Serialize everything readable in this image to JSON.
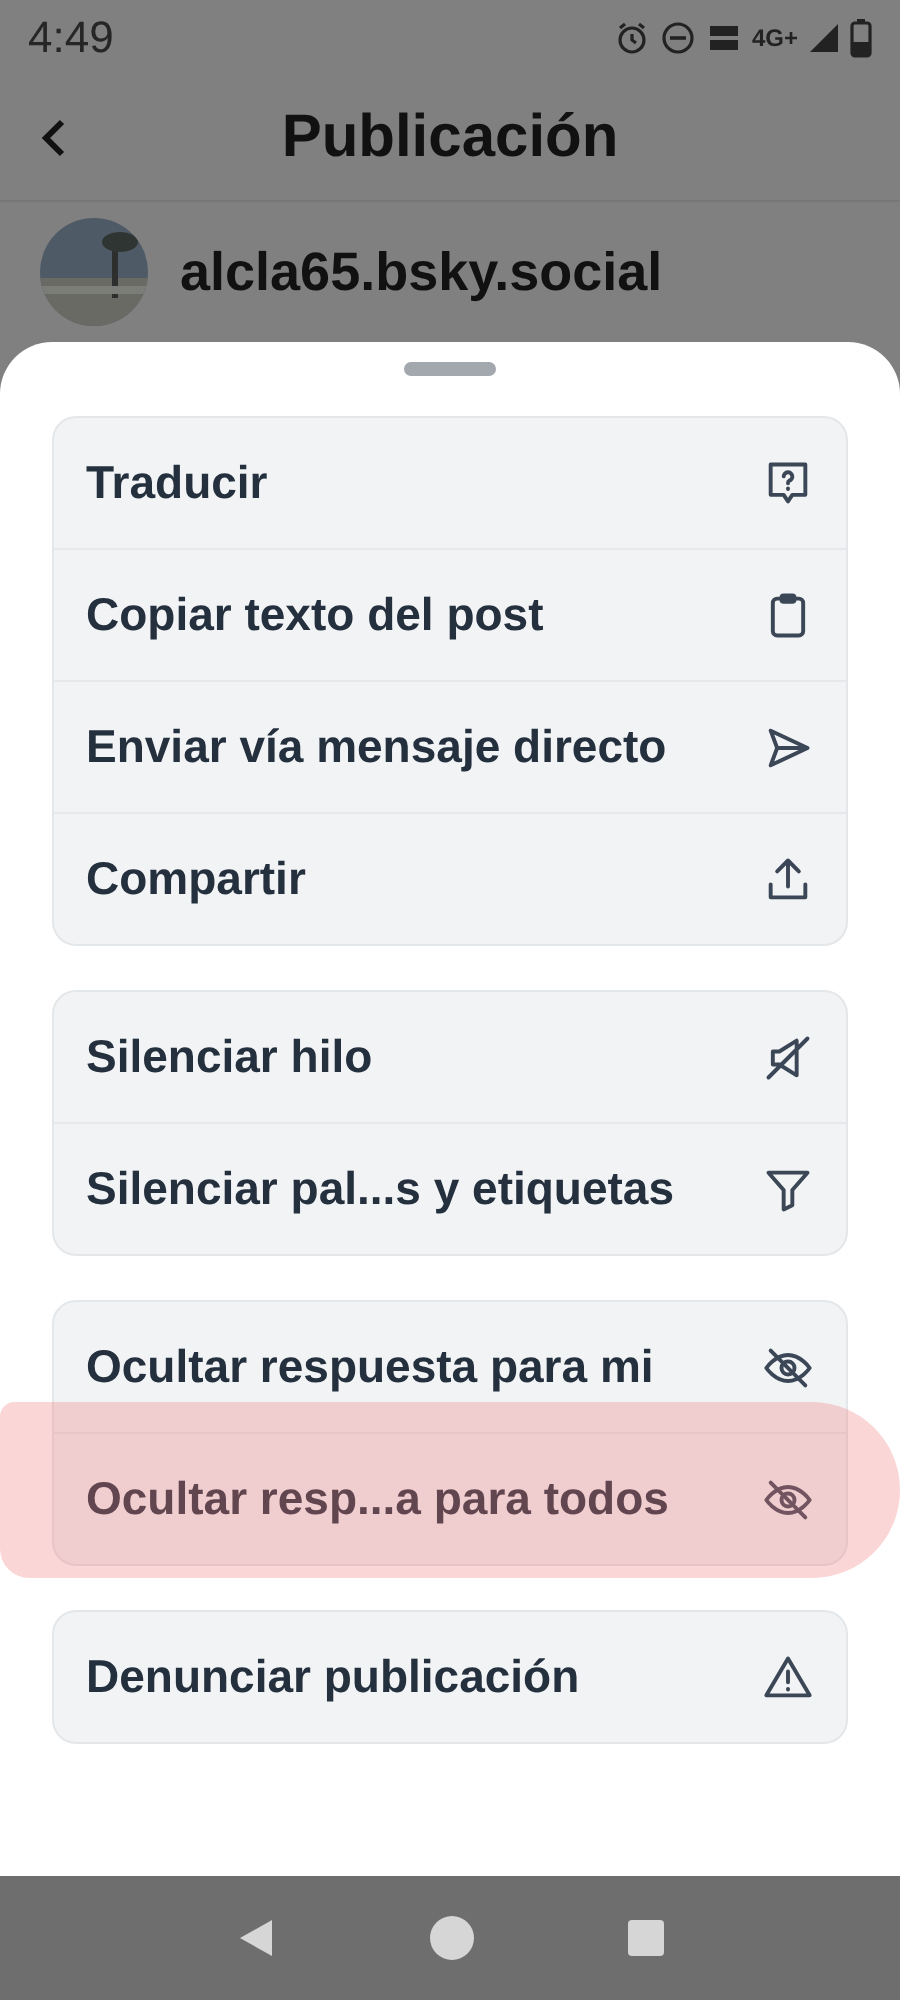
{
  "status_bar": {
    "time": "4:49",
    "network": "4G+"
  },
  "header": {
    "title": "Publicación"
  },
  "post": {
    "author": "alcla65.bsky.social"
  },
  "menu_groups": [
    {
      "items": [
        {
          "label": "Traducir",
          "kind": "translate",
          "highlighted": false
        },
        {
          "label": "Copiar texto del post",
          "kind": "clipboard",
          "highlighted": false
        },
        {
          "label": "Enviar vía mensaje directo",
          "kind": "send",
          "highlighted": false
        },
        {
          "label": "Compartir",
          "kind": "share",
          "highlighted": false
        }
      ]
    },
    {
      "items": [
        {
          "label": "Silenciar hilo",
          "kind": "mute",
          "highlighted": false
        },
        {
          "label": "Silenciar pal...s y etiquetas",
          "kind": "filter",
          "highlighted": false
        }
      ]
    },
    {
      "items": [
        {
          "label": "Ocultar respuesta para mi",
          "kind": "eyeoff",
          "highlighted": false
        },
        {
          "label": "Ocultar resp...a para todos",
          "kind": "eyeoff",
          "highlighted": true
        }
      ]
    },
    {
      "items": [
        {
          "label": "Denunciar publicación",
          "kind": "warning",
          "highlighted": false
        }
      ]
    }
  ]
}
